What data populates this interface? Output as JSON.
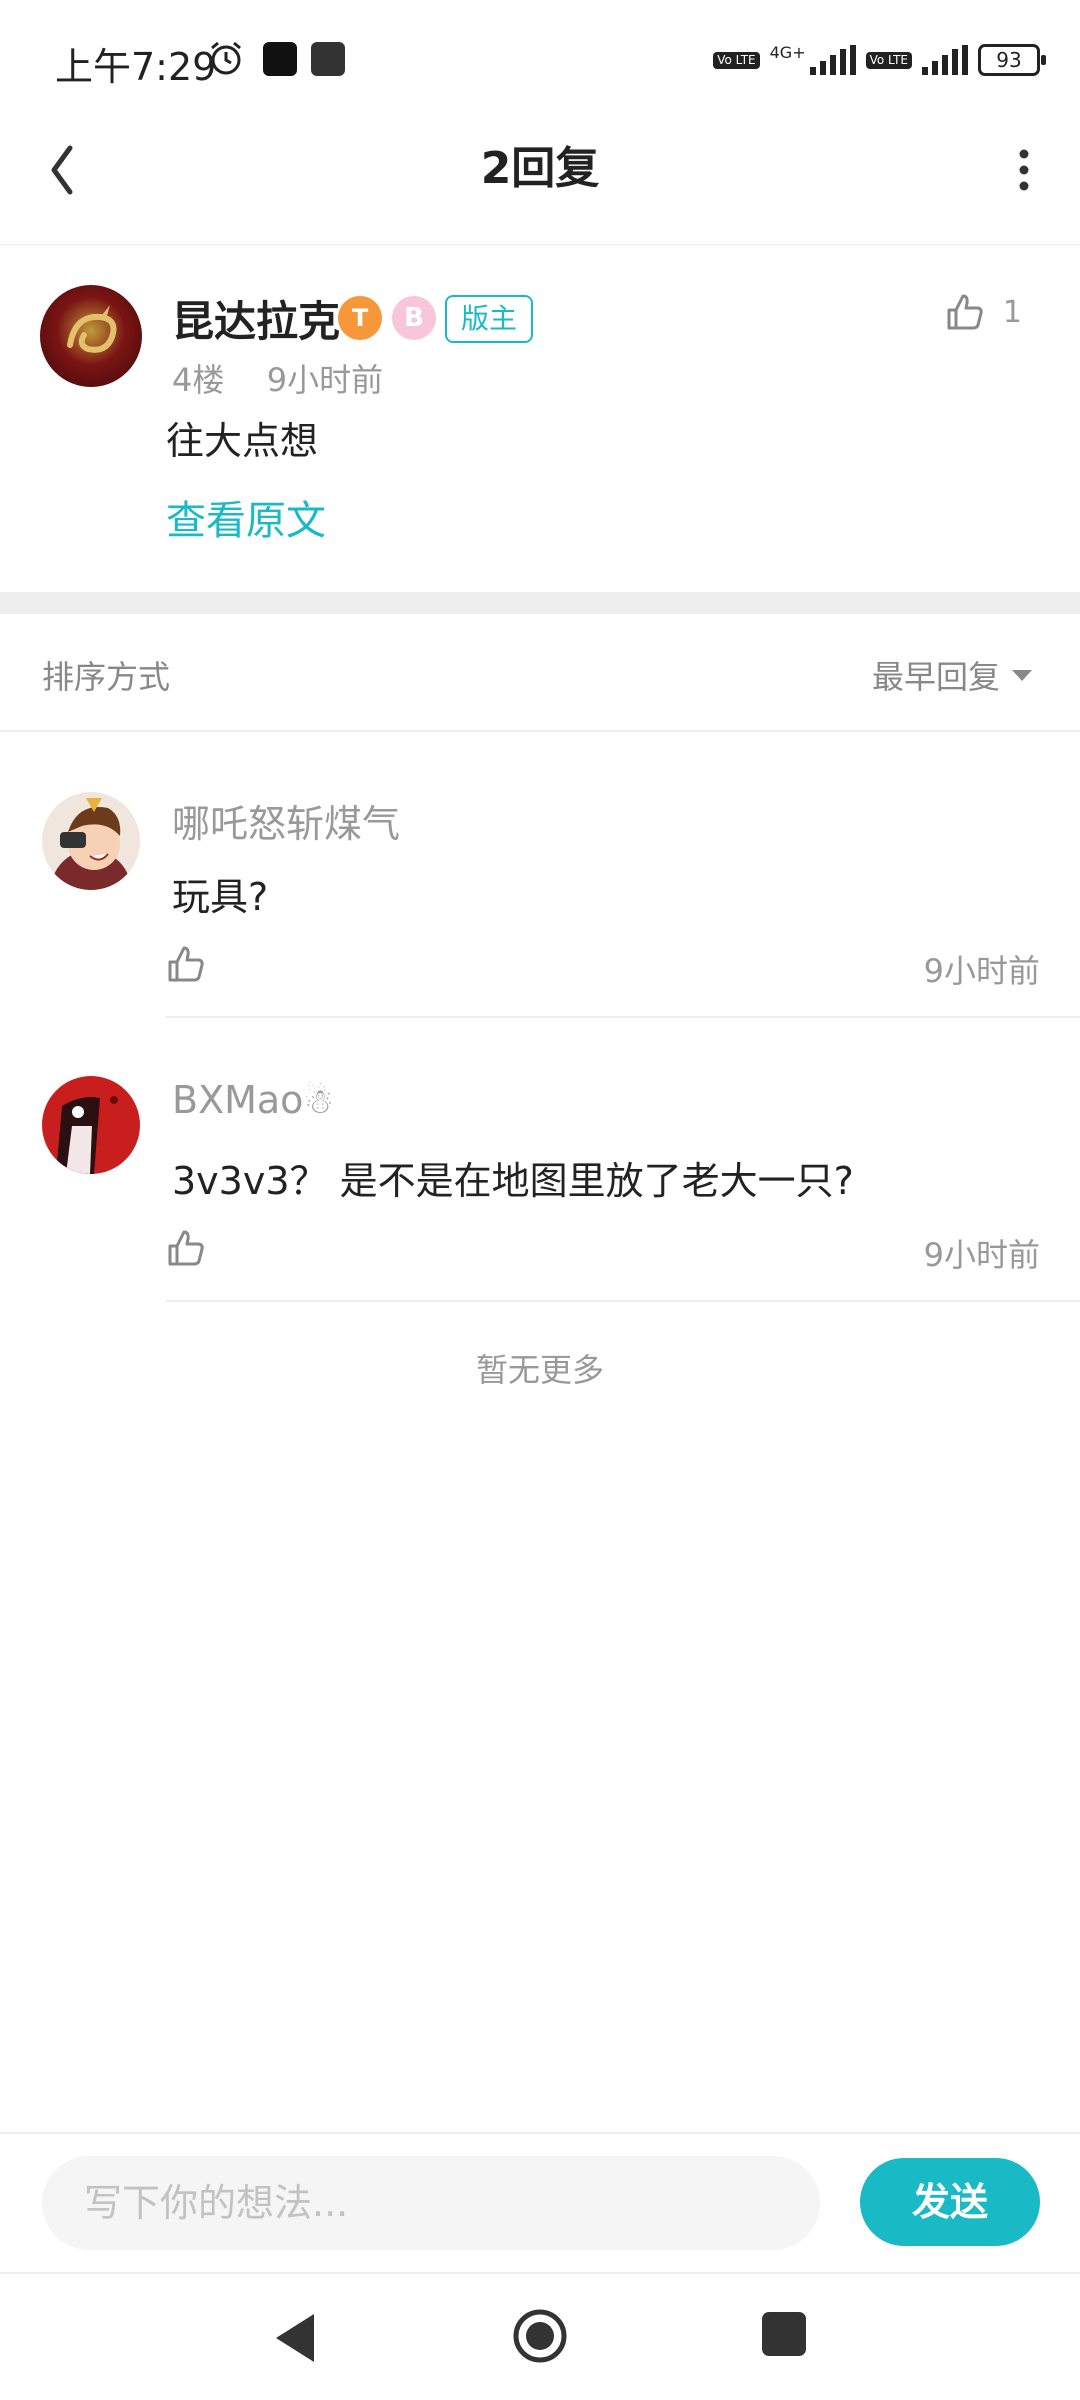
{
  "status_bar": {
    "time": "上午7:29",
    "network": "4G+",
    "volte1": "Vo LTE",
    "volte2": "Vo LTE",
    "battery": "93"
  },
  "header": {
    "title": "2回复"
  },
  "post": {
    "author": "昆达拉克",
    "level_badge": "T",
    "b_badge": "B",
    "mod_badge": "版主",
    "floor": "4楼",
    "time": "9小时前",
    "likes": "1",
    "content": "往大点想",
    "view_original": "查看原文"
  },
  "sort": {
    "label": "排序方式",
    "selected": "最早回复"
  },
  "replies": [
    {
      "name": "哪吒怒斩煤气",
      "text": "玩具?",
      "time": "9小时前"
    },
    {
      "name": "BXMao",
      "text": "3v3v3？ 是不是在地图里放了老大一只?",
      "time": "9小时前"
    }
  ],
  "footer_note": "暂无更多",
  "input": {
    "placeholder": "写下你的想法...",
    "send_label": "发送"
  },
  "colors": {
    "accent": "#19b9c6",
    "mod_badge": "#19b9c6",
    "level_badge": "#f6983a"
  },
  "icons": [
    "back-arrow-icon",
    "more-vertical-icon",
    "alarm-icon",
    "thumbs-up-icon",
    "caret-down-icon",
    "snowman-icon",
    "nav-back-icon",
    "nav-home-icon",
    "nav-recent-icon"
  ]
}
